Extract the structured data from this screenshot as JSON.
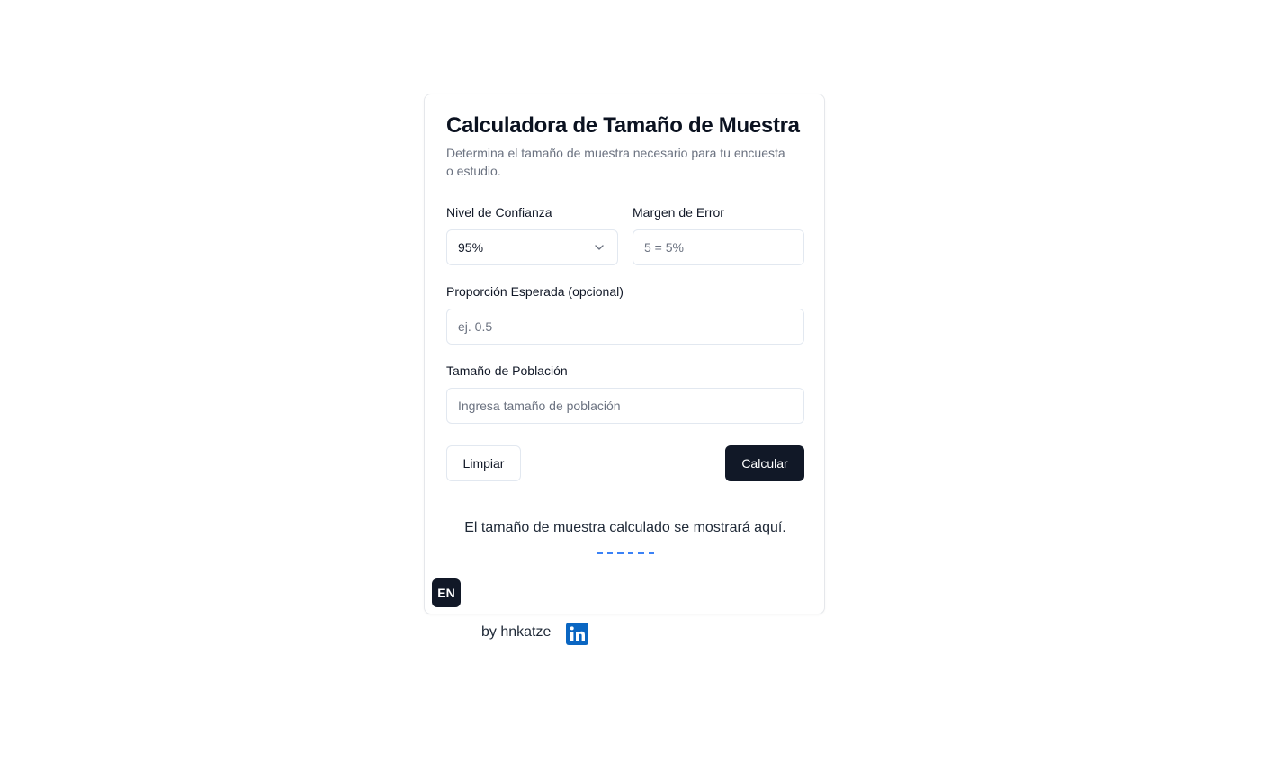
{
  "card": {
    "title": "Calculadora de Tamaño de Muestra",
    "subtitle": "Determina el tamaño de muestra necesario para tu encuesta o estudio."
  },
  "confidence": {
    "label": "Nivel de Confianza",
    "selected": "95%"
  },
  "margin": {
    "label": "Margen de Error",
    "placeholder": "5 = 5%"
  },
  "proportion": {
    "label": "Proporción Esperada (opcional)",
    "placeholder": "ej. 0.5"
  },
  "population": {
    "label": "Tamaño de Población",
    "placeholder": "Ingresa tamaño de población"
  },
  "actions": {
    "clear_label": "Limpiar",
    "calculate_label": "Calcular"
  },
  "result": {
    "text": "El tamaño de muestra calculado se mostrará aquí.",
    "placeholder_color": "#3b82f6"
  },
  "language_toggle": "EN",
  "footer": {
    "byline": "by hnkatze",
    "social_icon": "linkedin-icon",
    "social_color": "#0a66c2"
  },
  "colors": {
    "primary": "#111827",
    "border": "#e2e8f0",
    "muted_text": "#6b7280"
  }
}
